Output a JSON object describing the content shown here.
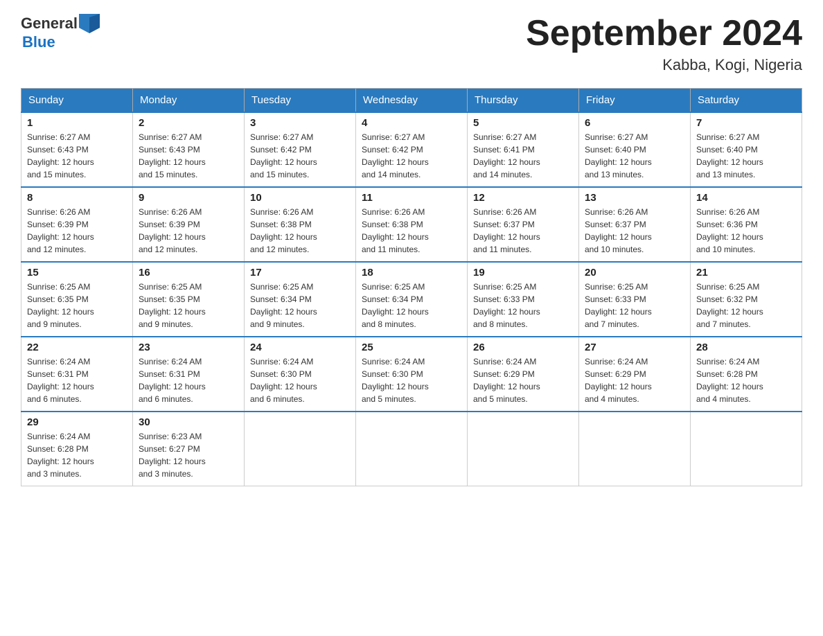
{
  "header": {
    "logo_general": "General",
    "logo_blue": "Blue",
    "month_title": "September 2024",
    "location": "Kabba, Kogi, Nigeria"
  },
  "days_of_week": [
    "Sunday",
    "Monday",
    "Tuesday",
    "Wednesday",
    "Thursday",
    "Friday",
    "Saturday"
  ],
  "weeks": [
    [
      {
        "day": "1",
        "sunrise": "6:27 AM",
        "sunset": "6:43 PM",
        "daylight": "12 hours and 15 minutes."
      },
      {
        "day": "2",
        "sunrise": "6:27 AM",
        "sunset": "6:43 PM",
        "daylight": "12 hours and 15 minutes."
      },
      {
        "day": "3",
        "sunrise": "6:27 AM",
        "sunset": "6:42 PM",
        "daylight": "12 hours and 15 minutes."
      },
      {
        "day": "4",
        "sunrise": "6:27 AM",
        "sunset": "6:42 PM",
        "daylight": "12 hours and 14 minutes."
      },
      {
        "day": "5",
        "sunrise": "6:27 AM",
        "sunset": "6:41 PM",
        "daylight": "12 hours and 14 minutes."
      },
      {
        "day": "6",
        "sunrise": "6:27 AM",
        "sunset": "6:40 PM",
        "daylight": "12 hours and 13 minutes."
      },
      {
        "day": "7",
        "sunrise": "6:27 AM",
        "sunset": "6:40 PM",
        "daylight": "12 hours and 13 minutes."
      }
    ],
    [
      {
        "day": "8",
        "sunrise": "6:26 AM",
        "sunset": "6:39 PM",
        "daylight": "12 hours and 12 minutes."
      },
      {
        "day": "9",
        "sunrise": "6:26 AM",
        "sunset": "6:39 PM",
        "daylight": "12 hours and 12 minutes."
      },
      {
        "day": "10",
        "sunrise": "6:26 AM",
        "sunset": "6:38 PM",
        "daylight": "12 hours and 12 minutes."
      },
      {
        "day": "11",
        "sunrise": "6:26 AM",
        "sunset": "6:38 PM",
        "daylight": "12 hours and 11 minutes."
      },
      {
        "day": "12",
        "sunrise": "6:26 AM",
        "sunset": "6:37 PM",
        "daylight": "12 hours and 11 minutes."
      },
      {
        "day": "13",
        "sunrise": "6:26 AM",
        "sunset": "6:37 PM",
        "daylight": "12 hours and 10 minutes."
      },
      {
        "day": "14",
        "sunrise": "6:26 AM",
        "sunset": "6:36 PM",
        "daylight": "12 hours and 10 minutes."
      }
    ],
    [
      {
        "day": "15",
        "sunrise": "6:25 AM",
        "sunset": "6:35 PM",
        "daylight": "12 hours and 9 minutes."
      },
      {
        "day": "16",
        "sunrise": "6:25 AM",
        "sunset": "6:35 PM",
        "daylight": "12 hours and 9 minutes."
      },
      {
        "day": "17",
        "sunrise": "6:25 AM",
        "sunset": "6:34 PM",
        "daylight": "12 hours and 9 minutes."
      },
      {
        "day": "18",
        "sunrise": "6:25 AM",
        "sunset": "6:34 PM",
        "daylight": "12 hours and 8 minutes."
      },
      {
        "day": "19",
        "sunrise": "6:25 AM",
        "sunset": "6:33 PM",
        "daylight": "12 hours and 8 minutes."
      },
      {
        "day": "20",
        "sunrise": "6:25 AM",
        "sunset": "6:33 PM",
        "daylight": "12 hours and 7 minutes."
      },
      {
        "day": "21",
        "sunrise": "6:25 AM",
        "sunset": "6:32 PM",
        "daylight": "12 hours and 7 minutes."
      }
    ],
    [
      {
        "day": "22",
        "sunrise": "6:24 AM",
        "sunset": "6:31 PM",
        "daylight": "12 hours and 6 minutes."
      },
      {
        "day": "23",
        "sunrise": "6:24 AM",
        "sunset": "6:31 PM",
        "daylight": "12 hours and 6 minutes."
      },
      {
        "day": "24",
        "sunrise": "6:24 AM",
        "sunset": "6:30 PM",
        "daylight": "12 hours and 6 minutes."
      },
      {
        "day": "25",
        "sunrise": "6:24 AM",
        "sunset": "6:30 PM",
        "daylight": "12 hours and 5 minutes."
      },
      {
        "day": "26",
        "sunrise": "6:24 AM",
        "sunset": "6:29 PM",
        "daylight": "12 hours and 5 minutes."
      },
      {
        "day": "27",
        "sunrise": "6:24 AM",
        "sunset": "6:29 PM",
        "daylight": "12 hours and 4 minutes."
      },
      {
        "day": "28",
        "sunrise": "6:24 AM",
        "sunset": "6:28 PM",
        "daylight": "12 hours and 4 minutes."
      }
    ],
    [
      {
        "day": "29",
        "sunrise": "6:24 AM",
        "sunset": "6:28 PM",
        "daylight": "12 hours and 3 minutes."
      },
      {
        "day": "30",
        "sunrise": "6:23 AM",
        "sunset": "6:27 PM",
        "daylight": "12 hours and 3 minutes."
      },
      null,
      null,
      null,
      null,
      null
    ]
  ],
  "labels": {
    "sunrise": "Sunrise:",
    "sunset": "Sunset:",
    "daylight": "Daylight:"
  }
}
